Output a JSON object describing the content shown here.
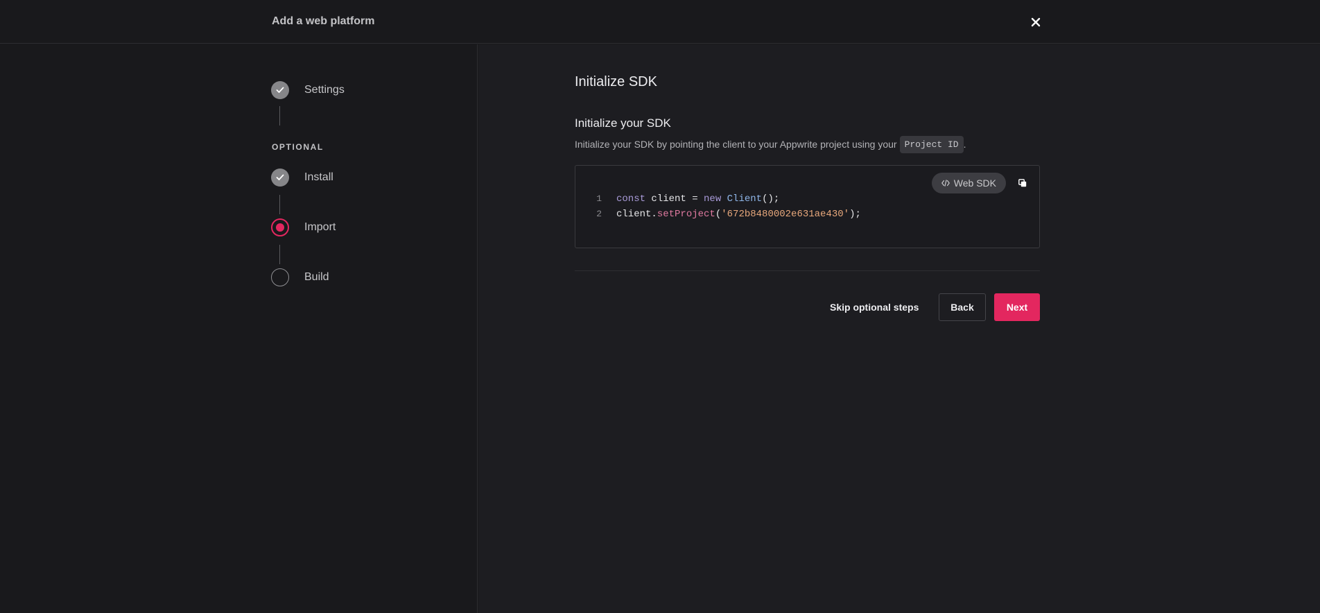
{
  "header": {
    "title": "Add a web platform",
    "close_icon": "close-icon"
  },
  "sidebar": {
    "steps": [
      {
        "label": "Settings",
        "state": "done"
      },
      {
        "label": "Install",
        "state": "done"
      },
      {
        "label": "Import",
        "state": "current"
      },
      {
        "label": "Build",
        "state": "todo"
      }
    ],
    "optional_label": "OPTIONAL"
  },
  "main": {
    "title": "Initialize SDK",
    "subtitle": "Initialize your SDK",
    "description": "Initialize your SDK by pointing the client to your Appwrite project using your",
    "project_id_tag": "Project ID",
    "description_end": ".",
    "code": {
      "sdk_label": "Web SDK",
      "lines": [
        {
          "number": "1",
          "text": "const client = new Client();"
        },
        {
          "number": "2",
          "text": "client.setProject('672b8480002e631ae430');"
        }
      ],
      "tokens": {
        "const_kw": "const",
        "client_var": " client = ",
        "new_kw": "new",
        "client_cls": "Client",
        "line1_end": "();",
        "client_obj": "client.",
        "set_project_fn": "setProject",
        "paren_open": "(",
        "project_str": "'672b8480002e631ae430'",
        "line2_end": ");"
      }
    },
    "actions": {
      "skip": "Skip optional steps",
      "back": "Back",
      "next": "Next"
    }
  },
  "colors": {
    "accent": "#e3275f",
    "background": "#19191c",
    "panel": "#1d1d21"
  }
}
